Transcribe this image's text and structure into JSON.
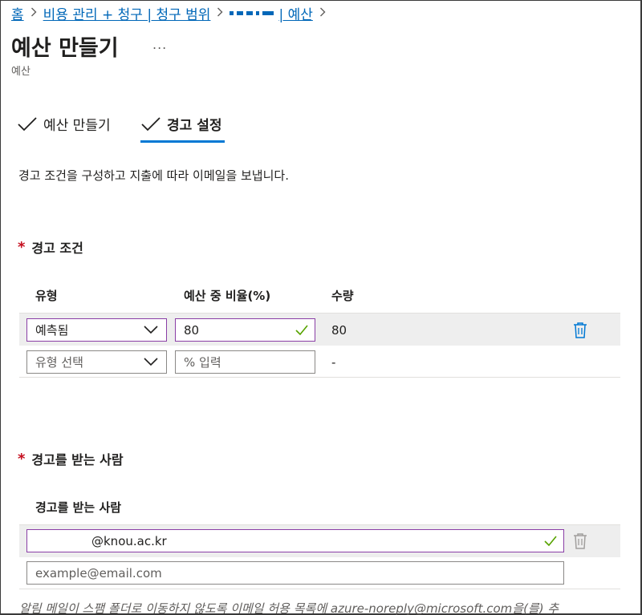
{
  "breadcrumb": {
    "home": "홈",
    "cost": "비용 관리 + 청구 | 청구 범위",
    "current": "| 예산"
  },
  "header": {
    "title": "예산 만들기",
    "more": "...",
    "subtitle": "예산"
  },
  "steps": [
    {
      "label": "예산 만들기"
    },
    {
      "label": "경고 설정"
    }
  ],
  "description": "경고 조건을 구성하고 지출에 따라 이메일을 보냅니다.",
  "alert_conditions": {
    "title": "경고 조건",
    "required_mark": "*",
    "columns": {
      "type": "유형",
      "percent": "예산 중 비율(%)",
      "amount": "수량"
    },
    "rows": [
      {
        "type": "예측됨",
        "percent": "80",
        "amount": "80"
      },
      {
        "type_placeholder": "유형 선택",
        "percent_placeholder": "% 입력",
        "amount": "-"
      }
    ]
  },
  "recipients": {
    "title": "경고를 받는 사람",
    "required_mark": "*",
    "column": "경고를 받는 사람",
    "emails": [
      {
        "value": "@knou.ac.kr"
      },
      {
        "placeholder": "example@email.com"
      }
    ]
  },
  "footnote": "알림 메일이 스팸 폴더로 이동하지 않도록 이메일 허용 목록에 azure-noreply@microsoft.com을(를) 추",
  "colors": {
    "accent": "#0078d4",
    "link": "#0067b8",
    "valid": "#57a300",
    "required": "#c50f1f",
    "focus": "#8a3ea6"
  }
}
